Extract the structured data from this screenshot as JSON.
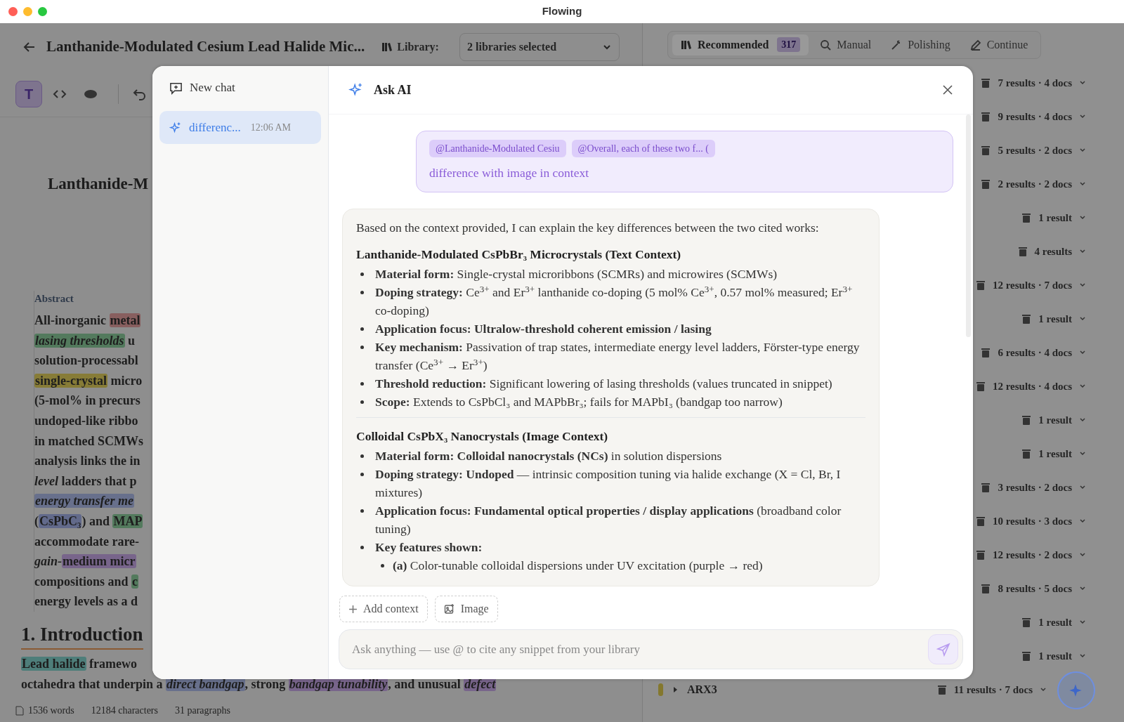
{
  "window": {
    "title": "Flowing"
  },
  "editor": {
    "title": "Lanthanide-Modulated Cesium Lead Halide Mic...",
    "library_label": "Library:",
    "library_value": "2 libraries selected",
    "modes": [
      {
        "kind": "text",
        "label": "T",
        "selected": true
      },
      {
        "kind": "code",
        "selected": false
      },
      {
        "kind": "preview",
        "selected": false
      }
    ]
  },
  "document": {
    "title": "Lanthanide-M",
    "abstract_label": "Abstract",
    "abstract_lines": [
      [
        {
          "text": "All-inorganic "
        },
        {
          "text": "metal",
          "color": "#885f5f"
        }
      ],
      [
        {
          "text": "lasing thresholds",
          "color": "#537a5d",
          "italic": true
        },
        {
          "text": " u"
        }
      ],
      [
        {
          "text": "solution-processabl"
        }
      ],
      [
        {
          "text": "single-crystal",
          "color": "#877c37"
        },
        {
          "text": " micro"
        }
      ],
      [
        {
          "text": "(5-mol% in precurs"
        }
      ],
      [
        {
          "text": "undoped-like ribbo"
        }
      ],
      [
        {
          "text": "in matched SCMWs"
        }
      ],
      [
        {
          "text": "analysis links the in"
        }
      ],
      [
        {
          "text": "level",
          "italic": true
        },
        {
          "text": " ladders that p"
        }
      ],
      [
        {
          "text": "energy transfer me",
          "color": "#68708c",
          "italic": true
        }
      ],
      [
        {
          "text": "("
        },
        {
          "text": "CsPbC₃",
          "color": "#626a8b"
        },
        {
          "text": ") and "
        },
        {
          "text": "MAP",
          "color": "#537a5d"
        }
      ],
      [
        {
          "text": "accommodate rare-"
        }
      ],
      [
        {
          "text": "gain-",
          "italic": true
        },
        {
          "text": "medium micr",
          "color": "#78658b"
        }
      ],
      [
        {
          "text": "compositions and "
        },
        {
          "text": "c",
          "color": "#537a5d"
        }
      ],
      [
        {
          "text": "energy levels as a d"
        }
      ]
    ],
    "section_heading": "1. Introduction",
    "section_lines": [
      [
        {
          "text": "Lead halide",
          "color": "#4e7e7a"
        },
        {
          "text": " framewo"
        }
      ],
      [
        {
          "text": "octahedra that underpin a "
        },
        {
          "text": "direct bandgap",
          "color": "#68708c",
          "italic": true
        },
        {
          "text": ", strong "
        },
        {
          "text": "bandgap tunability",
          "color": "#78658b",
          "italic": true
        },
        {
          "text": ", and unusual "
        },
        {
          "text": "defect",
          "color": "#78658b",
          "italic": true
        }
      ]
    ]
  },
  "status_bar": {
    "words": "1536 words",
    "characters": "12184 characters",
    "paragraphs": "31 paragraphs"
  },
  "panel": {
    "tabs": [
      {
        "label": "Recommended",
        "badge": "317",
        "selected": true
      },
      {
        "label": "Manual",
        "selected": false
      },
      {
        "label": "Polishing",
        "selected": false
      },
      {
        "label": "Continue",
        "selected": false
      }
    ],
    "results": [
      {
        "count": "7 results · 4 docs"
      },
      {
        "count": "9 results · 4 docs"
      },
      {
        "count": "5 results · 2 docs"
      },
      {
        "count": "2 results · 2 docs"
      },
      {
        "count": "1 result"
      },
      {
        "count": "4 results"
      },
      {
        "count": "12 results · 7 docs"
      },
      {
        "count": "1 result"
      },
      {
        "count": "6 results · 4 docs"
      },
      {
        "count": "12 results · 4 docs"
      },
      {
        "count": "1 result"
      },
      {
        "count": "1 result"
      },
      {
        "count": "3 results · 2 docs"
      },
      {
        "count": "10 results · 3 docs"
      },
      {
        "count": "12 results · 2 docs"
      },
      {
        "count": "8 results · 5 docs"
      },
      {
        "count": "1 result"
      },
      {
        "count": "1 result"
      },
      {
        "count": "11 results · 7 docs",
        "label": "ARX3",
        "color": "#84782e"
      }
    ]
  },
  "chat": {
    "new_chat": "New chat",
    "history": [
      {
        "title": "differenc...",
        "time": "12:06 AM",
        "selected": true
      }
    ],
    "header": "Ask AI",
    "prompt": {
      "chips": [
        "@Lanthanide-Modulated Cesiu",
        "@Overall, each of these two f... ("
      ],
      "text": "difference with image in context"
    },
    "answer": [
      {
        "kind": "paragraph",
        "text": "Based on the context provided, I can explain the key differences between the two cited works:"
      },
      {
        "kind": "heading",
        "text": "Lanthanide-Modulated CsPbBr₃ Microcrystals (Text Context)"
      },
      {
        "kind": "list",
        "items": [
          {
            "text": "**Material form:** Single-crystal microribbons (SCMRs) and microwires (SCMWs)"
          },
          {
            "text": "**Doping strategy:** Ce$^{3+}$ and Er$^{3+}$ lanthanide co-doping (5 mol% Ce$^{3+}$, 0.57 mol% measured; Er$^{3+}$ co-doping)"
          },
          {
            "text": "**Application focus: Ultralow-threshold coherent emission / lasing**"
          },
          {
            "text": "**Key mechanism:** Passivation of trap states, intermediate energy level ladders, Förster-type energy transfer (Ce$^{3+}$ → Er$^{3+}$)"
          },
          {
            "text": "**Threshold reduction:** Significant lowering of lasing thresholds (values truncated in snippet)"
          },
          {
            "text": "**Scope:** Extends to CsPbCl₃ and MAPbBr₃; fails for MAPbI₃ (bandgap too narrow)"
          }
        ]
      },
      {
        "kind": "rule"
      },
      {
        "kind": "heading",
        "text": "Colloidal CsPbX₃ Nanocrystals (Image Context)"
      },
      {
        "kind": "list",
        "items": [
          {
            "text": "**Material form: Colloidal nanocrystals (NCs)** in solution dispersions"
          },
          {
            "text": "**Doping strategy: Undoped** — intrinsic composition tuning via halide exchange (X = Cl, Br, I mixtures)"
          },
          {
            "text": "**Application focus: Fundamental optical properties / display applications** (broadband color tuning)"
          },
          {
            "text": "**Key features shown:**",
            "children": [
              {
                "text": "**(a)** Color-tunable colloidal dispersions under UV excitation (purple → red)"
              }
            ]
          }
        ]
      }
    ],
    "actions": [
      {
        "kind": "add",
        "label": "Add context"
      },
      {
        "kind": "image",
        "label": "Image"
      }
    ],
    "input": {
      "placeholder": "Ask anything — use @ to cite any snippet from your library"
    }
  }
}
